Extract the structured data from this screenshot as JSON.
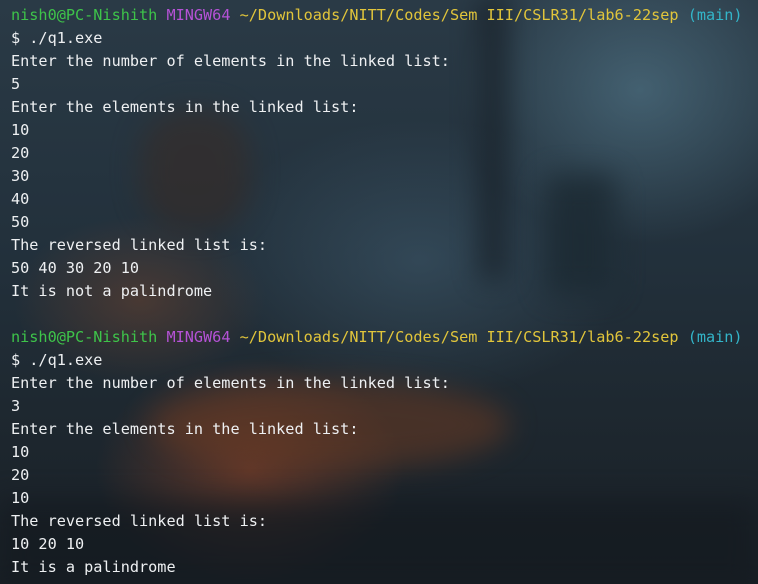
{
  "colors": {
    "user": "#3ec44a",
    "system": "#b552d6",
    "path": "#e1c53b",
    "branch": "#33b5c9",
    "text": "#eef0f2"
  },
  "sessions": [
    {
      "prompt": {
        "user": "nish0@PC-Nishith",
        "system": "MINGW64",
        "path": "~/Downloads/NITT/Codes/Sem III/CSLR31/lab6-22sep",
        "branch": "(main)"
      },
      "command": "$ ./q1.exe",
      "output": [
        "Enter the number of elements in the linked list:",
        "5",
        "Enter the elements in the linked list:",
        "10",
        "20",
        "30",
        "40",
        "50",
        "The reversed linked list is:",
        "50 40 30 20 10",
        "It is not a palindrome"
      ]
    },
    {
      "prompt": {
        "user": "nish0@PC-Nishith",
        "system": "MINGW64",
        "path": "~/Downloads/NITT/Codes/Sem III/CSLR31/lab6-22sep",
        "branch": "(main)"
      },
      "command": "$ ./q1.exe",
      "output": [
        "Enter the number of elements in the linked list:",
        "3",
        "Enter the elements in the linked list:",
        "10",
        "20",
        "10",
        "The reversed linked list is:",
        "10 20 10",
        "It is a palindrome"
      ]
    }
  ]
}
